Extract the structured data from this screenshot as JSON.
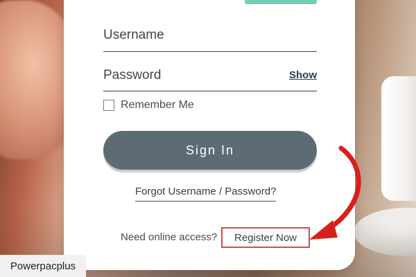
{
  "form": {
    "username_label": "Username",
    "password_label": "Password",
    "show_label": "Show",
    "remember_label": "Remember Me",
    "remember_checked": false,
    "signin_label": "Sign  In",
    "forgot_label": "Forgot Username / Password?",
    "need_access_text": "Need online access?",
    "register_label": "Register Now"
  },
  "colors": {
    "signin_button": "#5d6b75",
    "highlight_box": "#d84a45",
    "arrow": "#d7201b",
    "teal_accent": "#6fcfb7"
  },
  "watermark": "Powerpacplus"
}
